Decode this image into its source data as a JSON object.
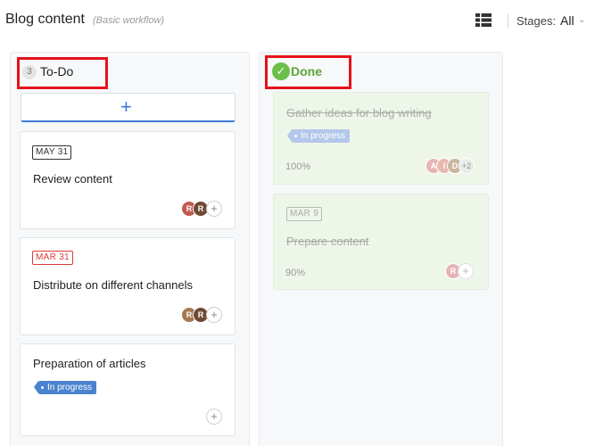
{
  "header": {
    "title": "Blog content",
    "subtitle": "(Basic workflow)",
    "view_icon": "grid-view-icon",
    "stages_label": "Stages:",
    "stages_value": "All"
  },
  "columns": [
    {
      "title": "To-Do",
      "count": "3",
      "add_icon": "plus-icon",
      "cards": [
        {
          "date": "MAY 31",
          "title": "Review content",
          "avatars": [
            "R",
            "R"
          ],
          "add_member": "+"
        },
        {
          "date": "MAR 31",
          "title": "Distribute on different channels",
          "avatars": [
            "R",
            "R"
          ],
          "add_member": "+"
        },
        {
          "title": "Preparation of articles",
          "status": "In progress",
          "add_member": "+"
        }
      ]
    },
    {
      "title": "Done",
      "status_icon": "check-circle-icon",
      "cards": [
        {
          "title": "Gather ideas for blog writing",
          "status": "In progress",
          "progress": "100%",
          "avatars": [
            "A",
            "I",
            "D"
          ],
          "more": "+2"
        },
        {
          "date": "MAR 9",
          "title": "Prepare content",
          "progress": "90%",
          "avatars": [
            "R"
          ],
          "add_member": "+"
        }
      ]
    }
  ],
  "colors": {
    "accent": "#3d7bd8",
    "done_green": "#6cc04a",
    "overdue_red": "#e03a3a",
    "highlight": "#e5121b"
  }
}
